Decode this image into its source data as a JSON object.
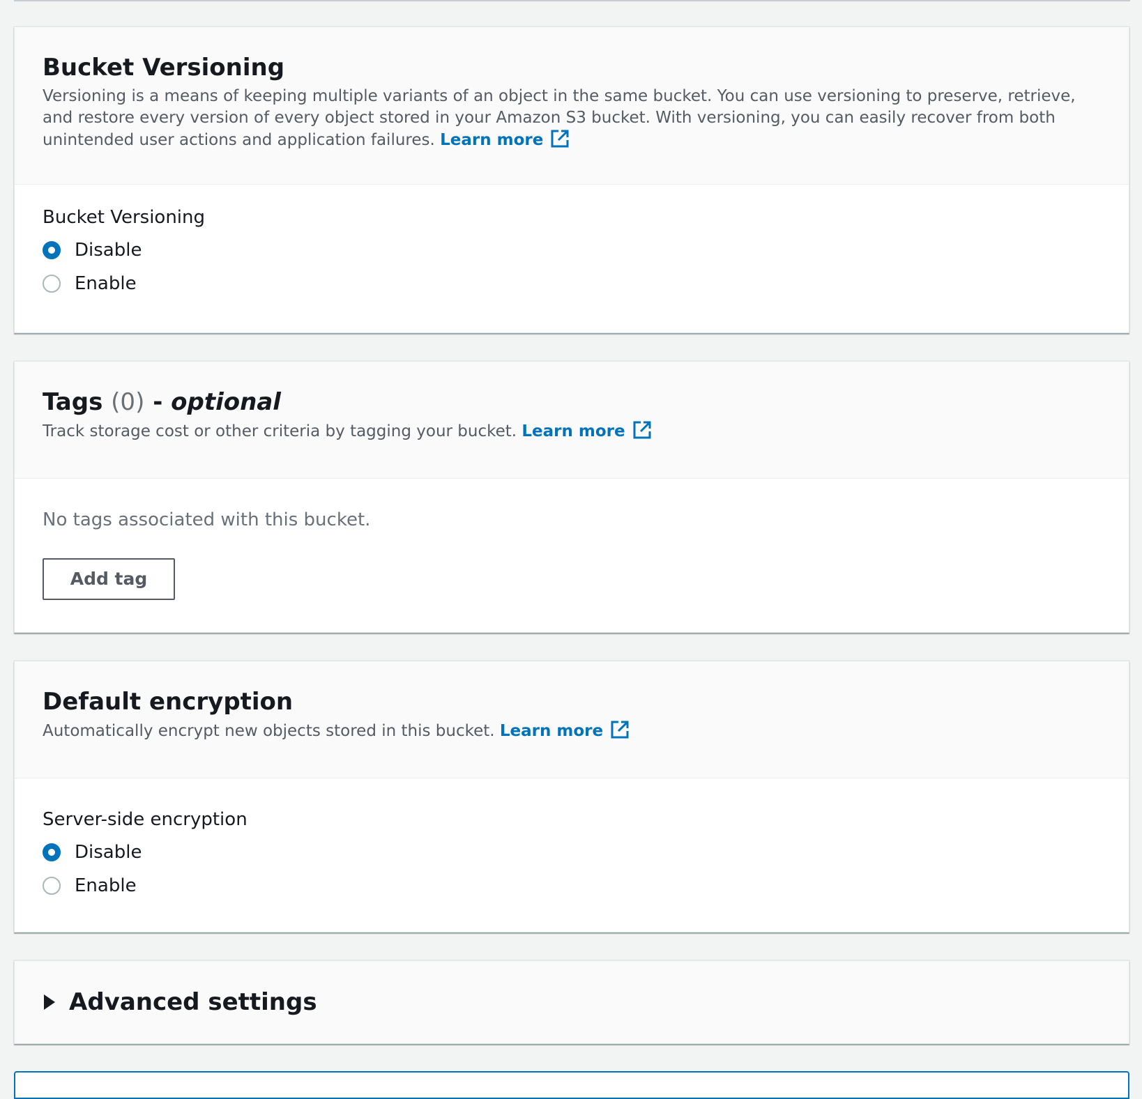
{
  "versioning": {
    "title": "Bucket Versioning",
    "description": "Versioning is a means of keeping multiple variants of an object in the same bucket. You can use versioning to preserve, retrieve, and restore every version of every object stored in your Amazon S3 bucket. With versioning, you can easily recover from both unintended user actions and application failures.",
    "learn_more": "Learn more",
    "field_label": "Bucket Versioning",
    "options": [
      {
        "label": "Disable",
        "selected": true
      },
      {
        "label": "Enable",
        "selected": false
      }
    ]
  },
  "tags": {
    "title": "Tags",
    "count": "(0)",
    "dash": "-",
    "optional": "optional",
    "description": "Track storage cost or other criteria by tagging your bucket.",
    "learn_more": "Learn more",
    "empty_text": "No tags associated with this bucket.",
    "add_button": "Add tag"
  },
  "encryption": {
    "title": "Default encryption",
    "description": "Automatically encrypt new objects stored in this bucket.",
    "learn_more": "Learn more",
    "field_label": "Server-side encryption",
    "options": [
      {
        "label": "Disable",
        "selected": true
      },
      {
        "label": "Enable",
        "selected": false
      }
    ]
  },
  "advanced": {
    "title": "Advanced settings",
    "expanded": false
  },
  "colors": {
    "link": "#0073bb",
    "radio_selected": "#0073bb",
    "background": "#f2f3f3"
  }
}
